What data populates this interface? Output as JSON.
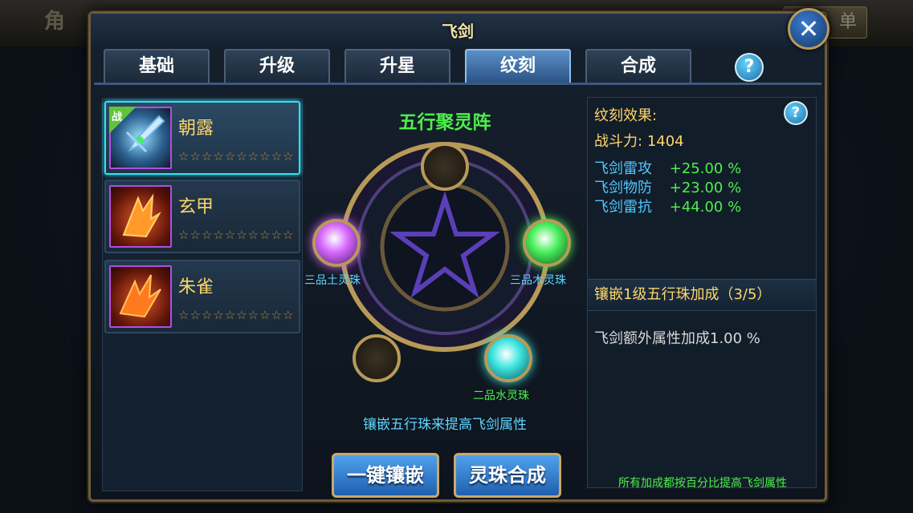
{
  "background": {
    "left_title": "角",
    "right_button": "单"
  },
  "panel": {
    "title": "飞剑"
  },
  "tabs": [
    {
      "label": "基础",
      "active": false
    },
    {
      "label": "升级",
      "active": false
    },
    {
      "label": "升星",
      "active": false
    },
    {
      "label": "纹刻",
      "active": true
    },
    {
      "label": "合成",
      "active": false
    }
  ],
  "help": {
    "label": "?"
  },
  "close": {
    "label": "✕"
  },
  "swords": [
    {
      "name": "朝露",
      "stars": "☆☆☆☆☆☆☆☆☆☆",
      "battle_tag": "战",
      "selected": true
    },
    {
      "name": "玄甲",
      "stars": "☆☆☆☆☆☆☆☆☆☆",
      "selected": false
    },
    {
      "name": "朱雀",
      "stars": "☆☆☆☆☆☆☆☆☆☆",
      "selected": false
    }
  ],
  "array": {
    "title": "五行聚灵阵",
    "gems": [
      {
        "label": "三品土灵珠",
        "color": "#d86bff"
      },
      {
        "label": "三品木灵珠",
        "color": "#4bf05e"
      },
      {
        "label": "二品水灵珠",
        "color": "#40e6e0"
      }
    ],
    "hint": "镶嵌五行珠来提高飞剑属性"
  },
  "buttons": {
    "inlay_all": "一键镶嵌",
    "combine": "灵珠合成"
  },
  "effects": {
    "title": "纹刻效果:",
    "power_label": "战斗力:",
    "power_value": "1404",
    "attrs": [
      {
        "name": "飞剑雷攻",
        "value": "+25.00 %"
      },
      {
        "name": "飞剑物防",
        "value": "+23.00 %"
      },
      {
        "name": "飞剑雷抗",
        "value": "+44.00 %"
      }
    ],
    "bonus_head": "镶嵌1级五行珠加成（3/5）",
    "bonus_text": "飞剑额外属性加成1.00 %",
    "footer": "所有加成都按百分比提高飞剑属性"
  },
  "colors": {
    "accent_green": "#4df04a",
    "accent_gold": "#ffd66a",
    "accent_blue": "#4fc7ff"
  }
}
